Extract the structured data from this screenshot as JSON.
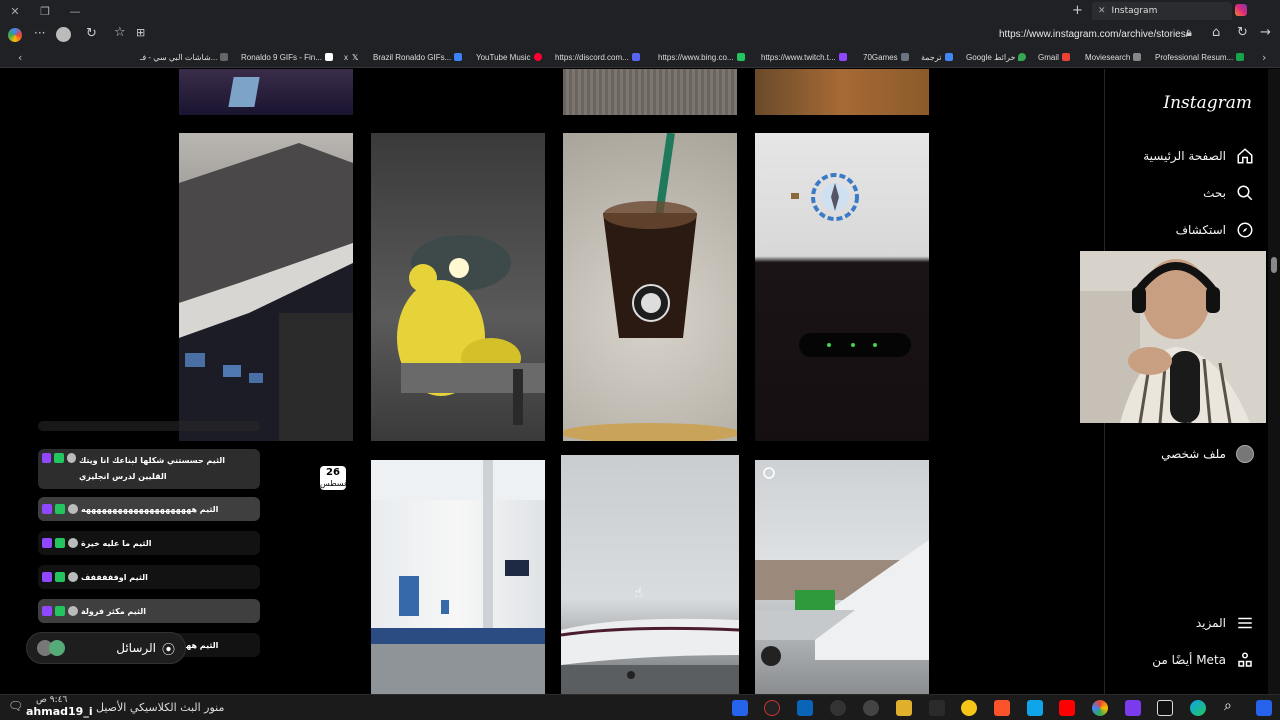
{
  "browser": {
    "tab_title": "Instagram",
    "url": "https://www.instagram.com/archive/stories/",
    "bookmarks": [
      "شاشات البي سي - فـ...",
      "Ronaldo 9 GIFs - Fin...",
      "x",
      "Brazil Ronaldo GIFs...",
      "YouTube Music",
      "https://discord.com...",
      "https://www.bing.co...",
      "https://www.twitch.t...",
      "70Games",
      "ترجمة",
      "Google خرائط",
      "Gmail",
      "Moviesearch",
      "Professional Resum..."
    ]
  },
  "sidebar": {
    "logo": "Instagram",
    "nav": [
      {
        "label": "الصفحة الرئيسية",
        "icon": "home-icon"
      },
      {
        "label": "بحث",
        "icon": "search-icon"
      },
      {
        "label": "استكشاف",
        "icon": "explore-icon"
      },
      {
        "label": "ملف شخصي",
        "icon": "profile-avatar"
      },
      {
        "label": "المزيد",
        "icon": "menu-icon"
      },
      {
        "label": "أيضًا من Meta",
        "icon": "meta-apps-icon"
      }
    ]
  },
  "archive": {
    "date_badge": {
      "day": "26",
      "month": "أغسطس"
    },
    "photos": [
      "plane-cabin",
      "yellow-bear-sculpture",
      "starbucks-iced-coffee",
      "in-flight-map-screen",
      "airport-gate-hall",
      "plane-on-tarmac",
      "plane-wing-view"
    ]
  },
  "chat": {
    "messages": [
      "الثيم حسستني شكلها لبناعك انا ويتك القليين لدرس انجليزي",
      "الثيم هههههههههههههههههههههه",
      "الثيم ما عليه خيرة",
      "الثيم اوفففففف",
      "الثيم مكثر فرولة",
      "الثيم هههههههههههههههههههههه"
    ],
    "messages_label": "الرسائل"
  },
  "taskbar": {
    "ticker": "منور البث الكلاسيكي الأصيل",
    "username": "ahmad19_i",
    "clock": "٩:٤٦ ص"
  }
}
